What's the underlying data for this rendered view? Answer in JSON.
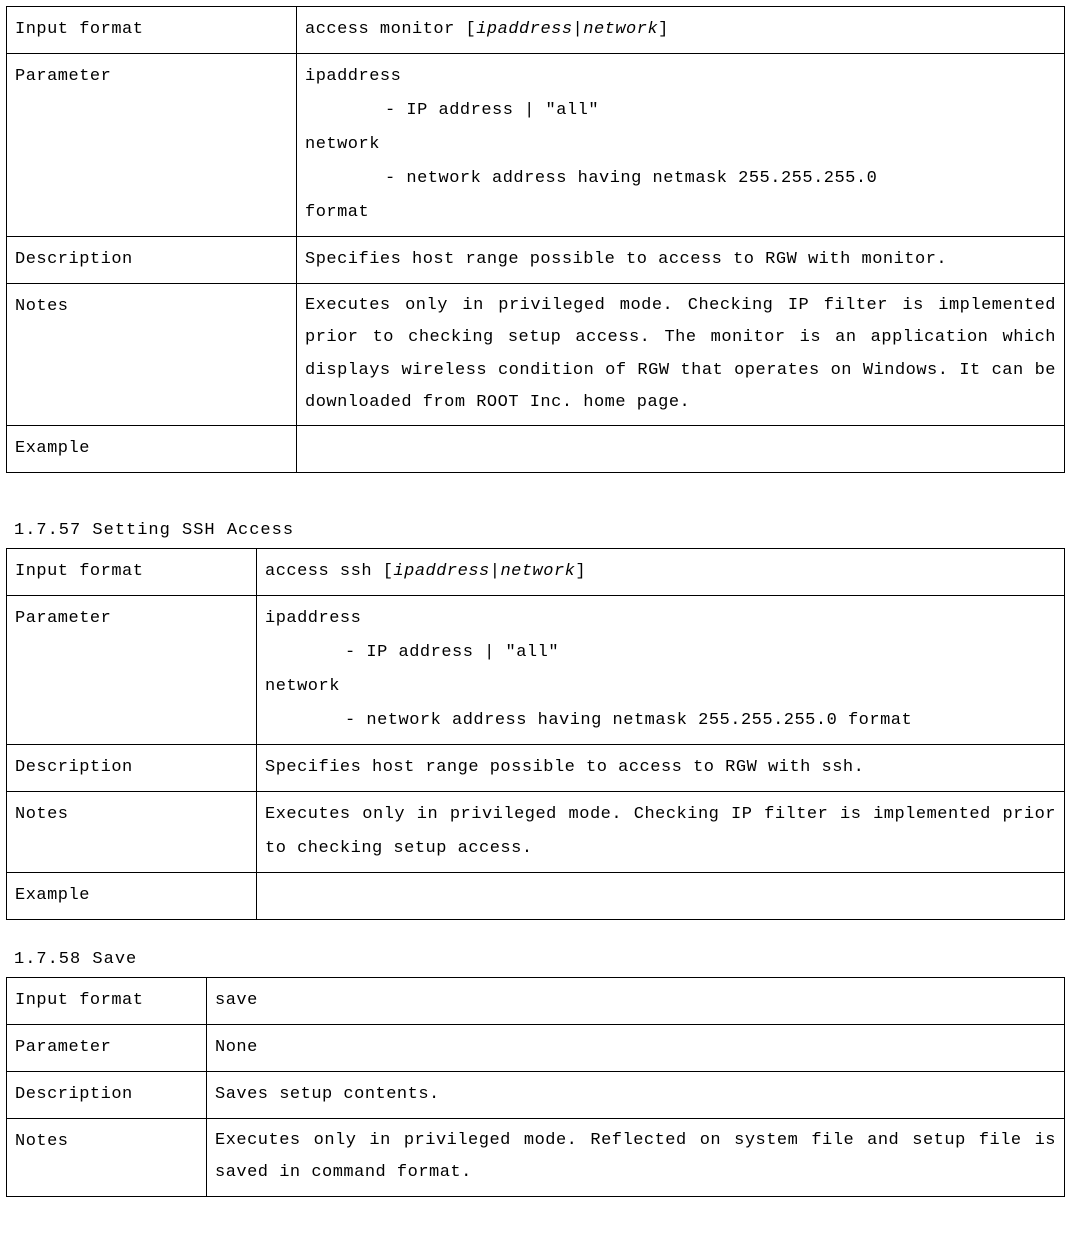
{
  "labels": {
    "input_format": "Input format",
    "parameter": "Parameter",
    "description": "Description",
    "notes": "Notes",
    "example": "Example"
  },
  "table1": {
    "input_format_prefix": "access monitor [",
    "input_format_italic": "ipaddress|network",
    "input_format_suffix": "]",
    "param_ip_label": "ipaddress",
    "param_ip_desc": "- IP address | \"all\"",
    "param_net_label": "network",
    "param_net_desc": "- network address having netmask 255.255.255.0",
    "param_format": "format",
    "description": "Specifies host range possible to access to RGW with monitor.",
    "notes": "Executes only in privileged mode. Checking IP filter is implemented prior to checking setup access. The monitor is an application which displays wireless condition of RGW that operates on Windows. It can be downloaded from ROOT Inc. home page.",
    "example": ""
  },
  "section2_heading": "1.7.57 Setting SSH Access",
  "table2": {
    "input_format_prefix": "access ssh [",
    "input_format_italic": "ipaddress|network",
    "input_format_suffix": "]",
    "param_ip_label": "ipaddress",
    "param_ip_desc": "- IP address | \"all\"",
    "param_net_label": "network",
    "param_net_desc": "- network address having netmask 255.255.255.0 format",
    "description": "Specifies host range possible to access to RGW with ssh.",
    "notes": "Executes only in privileged mode. Checking IP filter is implemented prior to checking setup access.",
    "example": ""
  },
  "section3_heading": "1.7.58 Save",
  "table3": {
    "input_format": "save",
    "parameter": "None",
    "description": "Saves setup contents.",
    "notes": " Executes only in privileged mode. Reflected on system file and setup file is saved in command format."
  }
}
